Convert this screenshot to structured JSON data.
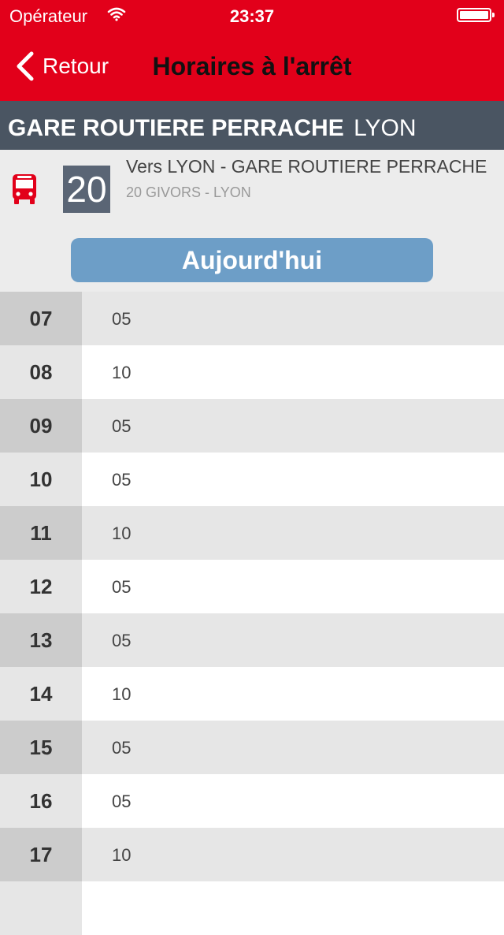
{
  "status_bar": {
    "carrier": "Opérateur",
    "time": "23:37"
  },
  "nav": {
    "back_label": "Retour",
    "title": "Horaires à l'arrêt"
  },
  "stop": {
    "name": "GARE ROUTIERE PERRACHE",
    "city": "LYON"
  },
  "line": {
    "number": "20",
    "direction": "Vers LYON - GARE ROUTIERE PERRACHE",
    "route": "20 GIVORS - LYON",
    "icon": "bus-icon"
  },
  "today_label": "Aujourd'hui",
  "colors": {
    "brand_red": "#e2001a",
    "header_slate": "#4a5562",
    "badge": "#5a6575",
    "today_blue": "#6d9ec7"
  },
  "schedule": [
    {
      "hour": "07",
      "minutes": "05"
    },
    {
      "hour": "08",
      "minutes": "10"
    },
    {
      "hour": "09",
      "minutes": "05"
    },
    {
      "hour": "10",
      "minutes": "05"
    },
    {
      "hour": "11",
      "minutes": "10"
    },
    {
      "hour": "12",
      "minutes": "05"
    },
    {
      "hour": "13",
      "minutes": "05"
    },
    {
      "hour": "14",
      "minutes": "10"
    },
    {
      "hour": "15",
      "minutes": "05"
    },
    {
      "hour": "16",
      "minutes": "05"
    },
    {
      "hour": "17",
      "minutes": "10"
    }
  ]
}
